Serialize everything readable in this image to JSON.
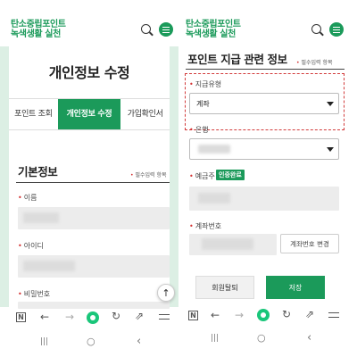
{
  "colors": {
    "brand_green": "#1b9a5a",
    "highlight_red": "#d23b3b",
    "panel_mint": "#dcefe4"
  },
  "left": {
    "brand_line1": "탄소중립포인트",
    "brand_line2": "녹색생활 실천",
    "page_title": "개인정보 수정",
    "tabs": [
      {
        "label": "포인트 조회",
        "active": false
      },
      {
        "label": "개인정보 수정",
        "active": true
      },
      {
        "label": "가입확인서",
        "active": false
      }
    ],
    "section_title": "기본정보",
    "required_note": "필수입력 항목",
    "required_mark": "•",
    "fields": [
      {
        "label": "이름"
      },
      {
        "label": "아이디"
      },
      {
        "label": "비밀번호"
      }
    ],
    "scroll_top_icon": "arrow-up-icon"
  },
  "right": {
    "brand_line1": "탄소중립포인트",
    "brand_line2": "녹색생활 실천",
    "section_title": "포인트 지급 관련 정보",
    "required_note": "필수입력 항목",
    "required_mark": "•",
    "payment_type_label": "지급유형",
    "payment_type_value": "계좌",
    "bank_label": "은행",
    "depositor_label": "예금주",
    "verified_badge": "인증완료",
    "account_label": "계좌번호",
    "change_account_button": "계좌번호 변경",
    "withdraw_button": "회원탈퇴",
    "save_button": "저장"
  },
  "browser_bar": {
    "n_icon": "N",
    "icons": [
      "n-icon",
      "back-icon",
      "forward-icon",
      "home-icon",
      "refresh-icon",
      "share-icon",
      "menu-icon"
    ]
  },
  "system_nav": {
    "recent": "|||",
    "home": "○",
    "back": "‹"
  }
}
